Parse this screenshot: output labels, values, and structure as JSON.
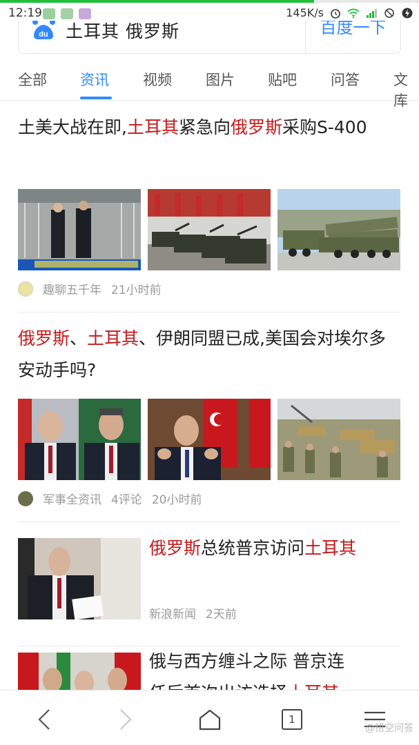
{
  "status_bar": {
    "time": "12:19",
    "speed": "145K/s",
    "progress": 0.75,
    "icons": [
      "app-icon-1",
      "app-icon-2",
      "app-icon-3",
      "alarm-icon",
      "wifi-icon",
      "signal-icon",
      "no-sim-icon",
      "charging-icon"
    ]
  },
  "search": {
    "logo_text": "du",
    "query": "土耳其 俄罗斯",
    "button_label": "百度一下"
  },
  "tabs": [
    {
      "label": "全部",
      "active": false
    },
    {
      "label": "资讯",
      "active": true
    },
    {
      "label": "视频",
      "active": false
    },
    {
      "label": "图片",
      "active": false
    },
    {
      "label": "贴吧",
      "active": false
    },
    {
      "label": "问答",
      "active": false
    },
    {
      "label": "文库",
      "active": false
    }
  ],
  "feed": {
    "item1": {
      "title": [
        "土美大战在即,",
        "土耳其",
        "紧急向",
        "俄罗斯",
        "采购S-400"
      ],
      "source": "趣聊五千年",
      "time": "21小时前"
    },
    "item2": {
      "title": [
        "俄罗斯",
        "、",
        "土耳其",
        "、伊朗同盟已成,美国会对埃尔多安动手吗?"
      ],
      "source": "军事全资讯",
      "comments": "4评论",
      "time": "20小时前"
    },
    "item3": {
      "title": [
        "俄罗斯",
        "总统普京访问",
        "土耳其"
      ],
      "source": "新浪新闻",
      "time": "2天前"
    },
    "item4": {
      "title_line1": "俄与西方缠斗之际 普京连",
      "title_line2_prefix": "任后首次出访选择",
      "title_line2_hl": "土耳其"
    }
  },
  "bottom_bar": {
    "tab_count": "1",
    "watermark": "@悟空问答"
  },
  "colors": {
    "accent": "#3388ff",
    "highlight": "#c5191b",
    "meta": "#999999"
  }
}
